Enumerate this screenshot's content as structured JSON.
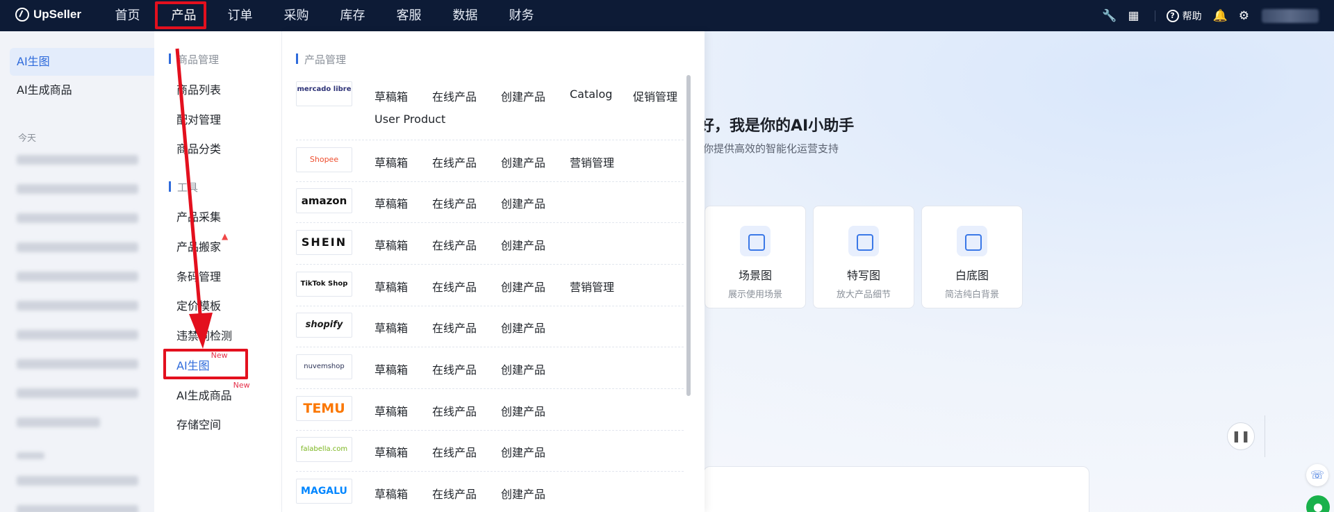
{
  "brand": {
    "name": "UpSeller"
  },
  "nav": {
    "items": [
      "首页",
      "产品",
      "订单",
      "采购",
      "库存",
      "客服",
      "数据",
      "财务"
    ],
    "active": "产品"
  },
  "topbar_right": {
    "help_label": "帮助"
  },
  "sidebar": {
    "items": [
      "AI生图",
      "AI生成商品"
    ],
    "active": "AI生图",
    "section_today": "今天"
  },
  "main": {
    "greeting": "好，我是你的AI小助手",
    "subtitle": "你提供高效的智能化运营支持",
    "cards": [
      {
        "title": "场景图",
        "desc": "展示使用场景"
      },
      {
        "title": "特写图",
        "desc": "放大产品细节"
      },
      {
        "title": "白底图",
        "desc": "简洁纯白背景"
      }
    ]
  },
  "menu_left": {
    "section1_title": "商品管理",
    "section1_items": [
      "商品列表",
      "配对管理",
      "商品分类"
    ],
    "section2_title": "工具",
    "section2_items": [
      "产品采集",
      "产品搬家",
      "条码管理",
      "定价模板",
      "违禁词检测",
      "AI生图",
      "AI生成商品",
      "存储空间"
    ],
    "new_tag": "New"
  },
  "menu_right": {
    "title": "产品管理",
    "platforms": [
      {
        "name": "mercado libre",
        "links": [
          "草稿箱",
          "在线产品",
          "创建产品",
          "Catalog",
          "促销管理",
          "User Product"
        ]
      },
      {
        "name": "Shopee",
        "links": [
          "草稿箱",
          "在线产品",
          "创建产品",
          "营销管理"
        ]
      },
      {
        "name": "amazon",
        "links": [
          "草稿箱",
          "在线产品",
          "创建产品"
        ]
      },
      {
        "name": "SHEIN",
        "links": [
          "草稿箱",
          "在线产品",
          "创建产品"
        ]
      },
      {
        "name": "TikTok Shop",
        "links": [
          "草稿箱",
          "在线产品",
          "创建产品",
          "营销管理"
        ]
      },
      {
        "name": "shopify",
        "links": [
          "草稿箱",
          "在线产品",
          "创建产品"
        ]
      },
      {
        "name": "nuvemshop",
        "links": [
          "草稿箱",
          "在线产品",
          "创建产品"
        ]
      },
      {
        "name": "TEMU",
        "links": [
          "草稿箱",
          "在线产品",
          "创建产品"
        ]
      },
      {
        "name": "falabella.com",
        "links": [
          "草稿箱",
          "在线产品",
          "创建产品"
        ]
      },
      {
        "name": "MAGALU",
        "links": [
          "草稿箱",
          "在线产品",
          "创建产品"
        ]
      }
    ]
  },
  "colors": {
    "topbar": "#0d1b36",
    "accent": "#2f6bdb",
    "annotation_red": "#e3101e",
    "new_tag": "#e5304a"
  }
}
